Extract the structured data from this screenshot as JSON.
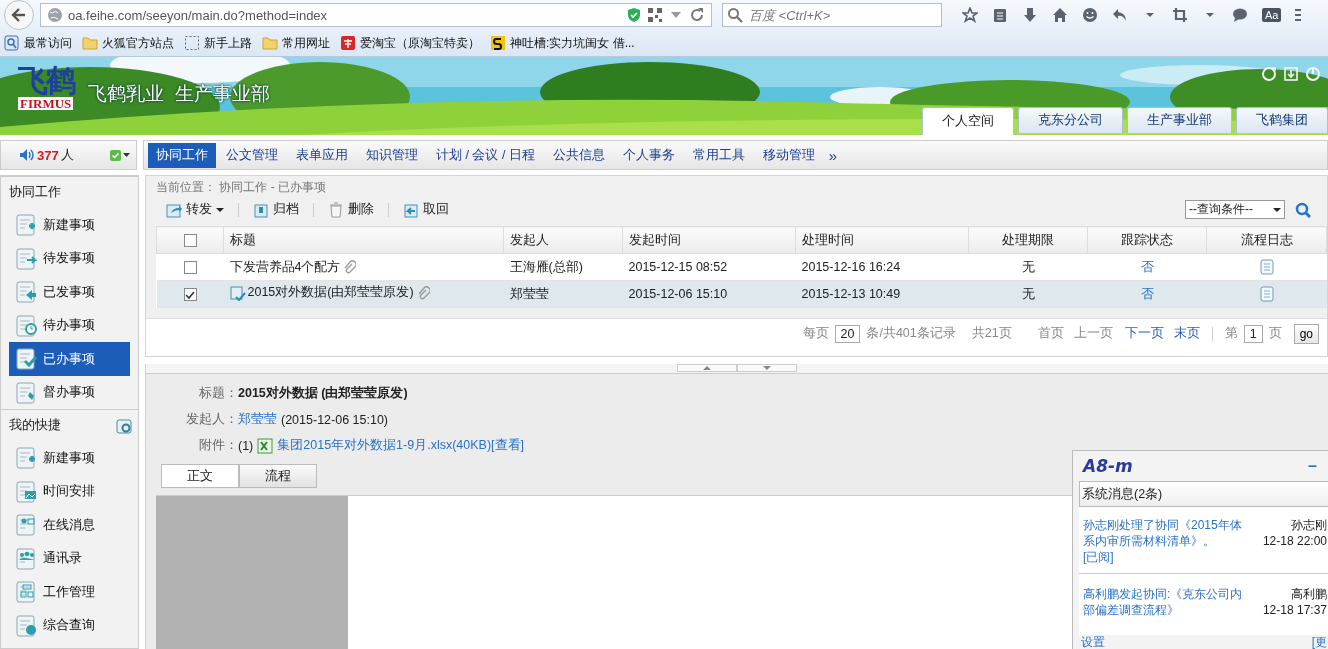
{
  "browser": {
    "url": "oa.feihe.com/seeyon/main.do?method=index",
    "search_placeholder": "百度 <Ctrl+K>",
    "reader_label": "Aa",
    "bookmarks": [
      {
        "label": "最常访问",
        "kind": "frequent"
      },
      {
        "label": "火狐官方站点",
        "kind": "folder"
      },
      {
        "label": "新手上路",
        "kind": "dashed"
      },
      {
        "label": "常用网址",
        "kind": "folder"
      },
      {
        "label": "爱淘宝（原淘宝特卖）",
        "kind": "tao"
      },
      {
        "label": "神吐槽:实力坑闺女 借...",
        "kind": "s"
      }
    ]
  },
  "banner": {
    "logo": "飞鹤",
    "logo_en": "FIRMUS",
    "title": "飞鹤乳业  生产事业部",
    "tabs": [
      {
        "label": "个人空间",
        "selected": true
      },
      {
        "label": "克东分公司",
        "selected": false
      },
      {
        "label": "生产事业部",
        "selected": false
      },
      {
        "label": "飞鹤集团",
        "selected": false
      }
    ]
  },
  "online": {
    "count": "377",
    "unit": "人"
  },
  "nav": {
    "more": "»",
    "items": [
      {
        "label": "协同工作",
        "selected": true
      },
      {
        "label": "公文管理",
        "selected": false
      },
      {
        "label": "表单应用",
        "selected": false
      },
      {
        "label": "知识管理",
        "selected": false
      },
      {
        "label": "计划 / 会议 / 日程",
        "selected": false
      },
      {
        "label": "公共信息",
        "selected": false
      },
      {
        "label": "个人事务",
        "selected": false
      },
      {
        "label": "常用工具",
        "selected": false
      },
      {
        "label": "移动管理",
        "selected": false
      }
    ]
  },
  "sidebar": {
    "sections": [
      {
        "title": "协同工作",
        "items": [
          {
            "label": "新建事项",
            "kind": "new",
            "selected": false
          },
          {
            "label": "待发事项",
            "kind": "pending",
            "selected": false
          },
          {
            "label": "已发事项",
            "kind": "sent",
            "selected": false
          },
          {
            "label": "待办事项",
            "kind": "todo",
            "selected": false
          },
          {
            "label": "已办事项",
            "kind": "done",
            "selected": true
          },
          {
            "label": "督办事项",
            "kind": "supervise",
            "selected": false
          }
        ]
      },
      {
        "title": "我的快捷",
        "settings": true,
        "items": [
          {
            "label": "新建事项",
            "kind": "new",
            "selected": false
          },
          {
            "label": "时间安排",
            "kind": "schedule",
            "selected": false
          },
          {
            "label": "在线消息",
            "kind": "message",
            "selected": false
          },
          {
            "label": "通讯录",
            "kind": "contacts",
            "selected": false
          },
          {
            "label": "工作管理",
            "kind": "work",
            "selected": false
          },
          {
            "label": "综合查询",
            "kind": "query",
            "selected": false
          }
        ]
      }
    ]
  },
  "list": {
    "breadcrumb": "当前位置： 协同工作 - 已办事项",
    "toolbar": [
      {
        "label": "转发",
        "kind": "forward",
        "dropdown": true
      },
      {
        "label": "归档",
        "kind": "archive",
        "dropdown": false
      },
      {
        "label": "删除",
        "kind": "delete",
        "dropdown": false
      },
      {
        "label": "取回",
        "kind": "retrieve",
        "dropdown": false
      }
    ],
    "query_select": "--查询条件--",
    "all_checked": false,
    "columns": [
      "标题",
      "发起人",
      "发起时间",
      "处理时间",
      "处理期限",
      "跟踪状态",
      "流程日志"
    ],
    "rows": [
      {
        "title": "下发营养品4个配方",
        "marked": false,
        "sender": "王海雁(总部)",
        "start": "2015-12-15 08:52",
        "handled": "2015-12-16 16:24",
        "deadline": "无",
        "tracking": "否",
        "checked": false,
        "selected": false
      },
      {
        "title": "2015对外数据(由郑莹莹原发)",
        "marked": true,
        "sender": "郑莹莹",
        "start": "2015-12-06 15:10",
        "handled": "2015-12-13 10:49",
        "deadline": "无",
        "tracking": "否",
        "checked": true,
        "selected": true
      }
    ],
    "pagination": {
      "per_page_label": "每页",
      "per_page": "20",
      "summary": "条/共401条记录",
      "pages": "共21页",
      "links": [
        {
          "label": "首页",
          "disabled": true
        },
        {
          "label": "上一页",
          "disabled": true
        },
        {
          "label": "下一页",
          "disabled": false
        },
        {
          "label": "末页",
          "disabled": false
        }
      ],
      "page_label": "第",
      "page": "1",
      "page_unit": "页",
      "go": "go"
    }
  },
  "detail": {
    "fields": [
      {
        "kind": "title",
        "label": "标题：",
        "value": "2015对外数据 (由郑莹莹原发)"
      },
      {
        "kind": "person",
        "label": "发起人：",
        "link": "郑莹莹",
        "value": "(2015-12-06 15:10)"
      },
      {
        "kind": "attachment",
        "label": "附件：",
        "count": "(1)",
        "file": "集团2015年对外数据1-9月.xlsx(40KB)",
        "view": "[查看]"
      }
    ],
    "tabs": [
      {
        "label": "正文",
        "selected": true
      },
      {
        "label": "流程",
        "selected": false
      }
    ]
  },
  "popup": {
    "brand": "A8-m",
    "minimize": "–",
    "header": "系统消息(2条)",
    "messages": [
      {
        "text": "孙志刚处理了协同《2015年体系内审所需材料清单》。",
        "status": "[已阅]",
        "sender": "孙志刚",
        "time": "12-18 22:00"
      },
      {
        "text": "高利鹏发起协同:《克东公司内部偏差调查流程》",
        "sender": "高利鹏",
        "time": "12-18 17:37"
      }
    ],
    "footer_left": "设置",
    "footer_right": "[更"
  }
}
